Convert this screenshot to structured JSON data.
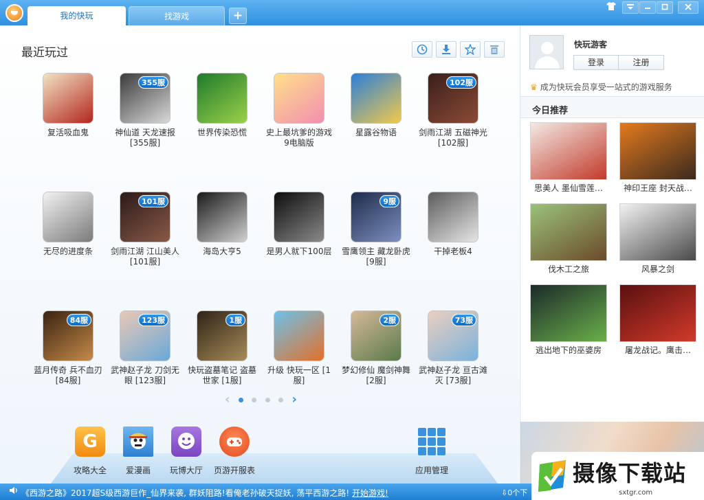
{
  "titlebar": {
    "tabs": [
      {
        "label": "我的快玩",
        "active": true
      },
      {
        "label": "找游戏",
        "active": false
      }
    ],
    "add_tab_label": "+",
    "skin_icon": "shirt-icon",
    "window_buttons": [
      "menu-icon",
      "minimize-icon",
      "maximize-icon",
      "close-icon"
    ]
  },
  "recent": {
    "title": "最近玩过",
    "tools": [
      "clock-icon",
      "download-icon",
      "star-icon",
      "trash-icon"
    ],
    "games": [
      {
        "name": "复活吸血鬼",
        "badge": "",
        "colors": [
          "#f2e3c4",
          "#b3261e"
        ]
      },
      {
        "name": "神仙道 天龙速报 [355服]",
        "badge": "355服",
        "colors": [
          "#3b3b3b",
          "#d9d9d9"
        ]
      },
      {
        "name": "世界传染恐慌",
        "badge": "",
        "colors": [
          "#1f7a2b",
          "#9bd14a"
        ]
      },
      {
        "name": "史上最坑爹的游戏9电脑版",
        "badge": "",
        "colors": [
          "#ffe08a",
          "#f28fb0"
        ]
      },
      {
        "name": "星露谷物语",
        "badge": "",
        "colors": [
          "#2a7fd8",
          "#f2c94c"
        ]
      },
      {
        "name": "剑雨江湖 五磁神光 [102服]",
        "badge": "102服",
        "colors": [
          "#3a1f1a",
          "#8c4b36"
        ]
      },
      {
        "name": "无尽的进度条",
        "badge": "",
        "colors": [
          "#f2f2f2",
          "#7a7a7a"
        ]
      },
      {
        "name": "剑雨江湖 江山美人 [101服]",
        "badge": "101服",
        "colors": [
          "#2c1a1a",
          "#8a5a46"
        ]
      },
      {
        "name": "海岛大亨5",
        "badge": "",
        "colors": [
          "#1a1a1a",
          "#d0d0d0"
        ]
      },
      {
        "name": "是男人就下100层",
        "badge": "",
        "colors": [
          "#0d0d0d",
          "#8a8a8a"
        ]
      },
      {
        "name": "雪鹰领主 藏龙卧虎 [9服]",
        "badge": "9服",
        "colors": [
          "#1e2c4a",
          "#7c8fc0"
        ]
      },
      {
        "name": "干掉老板4",
        "badge": "",
        "colors": [
          "#5b5b5b",
          "#e6e6e6"
        ]
      },
      {
        "name": "蓝月传奇 兵不血刃 [84服]",
        "badge": "84服",
        "colors": [
          "#3a2310",
          "#c58a4a"
        ]
      },
      {
        "name": "武神赵子龙 刀剑无眼 [123服]",
        "badge": "123服",
        "colors": [
          "#e9c9b6",
          "#6aa8d8"
        ]
      },
      {
        "name": "快玩盗墓笔记 盗墓世家 [1服]",
        "badge": "1服",
        "colors": [
          "#2e2416",
          "#a88b5a"
        ]
      },
      {
        "name": "升级 快玩一区 [1服]",
        "badge": "",
        "colors": [
          "#6cc2ea",
          "#e3702a"
        ]
      },
      {
        "name": "梦幻修仙 魔剑神舞 [2服]",
        "badge": "2服",
        "colors": [
          "#d5b999",
          "#5a7a4a"
        ]
      },
      {
        "name": "武神赵子龙 亘古滩灭 [73服]",
        "badge": "73服",
        "colors": [
          "#eccfbf",
          "#79b2dc"
        ]
      }
    ]
  },
  "pager": {
    "pages": 4,
    "current": 1
  },
  "apps": [
    {
      "label": "攻略大全",
      "icon": "guide-g-icon",
      "color": "#f5a623"
    },
    {
      "label": "爱漫画",
      "icon": "comic-pirate-icon",
      "color": "#3f8fd4"
    },
    {
      "label": "玩博大厅",
      "icon": "smile-chat-icon",
      "color": "#8a55c9"
    },
    {
      "label": "页游开服表",
      "icon": "gamepad-icon",
      "color": "#e8502a"
    },
    {
      "label": "应用管理",
      "icon": "app-grid-icon",
      "color": "#3a92dc"
    }
  ],
  "user": {
    "name": "快玩游客",
    "login": "登录",
    "register": "注册",
    "promo": "成为快玩会员享受一站式的游戏服务"
  },
  "today": {
    "title": "今日推荐",
    "items": [
      {
        "name": "思美人 墨仙雪莲…",
        "colors": [
          "#f3e9e4",
          "#c23a2a"
        ]
      },
      {
        "name": "神印王座 封天战…",
        "colors": [
          "#e47a1e",
          "#3a2a1e"
        ]
      },
      {
        "name": "伐木工之旅",
        "colors": [
          "#9bc27a",
          "#6b4a2a"
        ]
      },
      {
        "name": "风暴之剑",
        "colors": [
          "#f2f2f2",
          "#4a4a4a"
        ]
      },
      {
        "name": "逃出地下的巫婆房",
        "colors": [
          "#1c2a2a",
          "#6ab04a"
        ]
      },
      {
        "name": "屠龙战记。鹰击…",
        "colors": [
          "#5a1010",
          "#d23a2a"
        ]
      }
    ]
  },
  "status": {
    "news": "《西游之路》2017超S级西游巨作_仙界来袭, 群妖阻路!看俺老孙破天捉妖, 荡平西游之路!",
    "start": "开始游戏!",
    "downloads": "0个下"
  },
  "watermark": {
    "text": "摄像下载站",
    "url": "sxtgr.com"
  }
}
